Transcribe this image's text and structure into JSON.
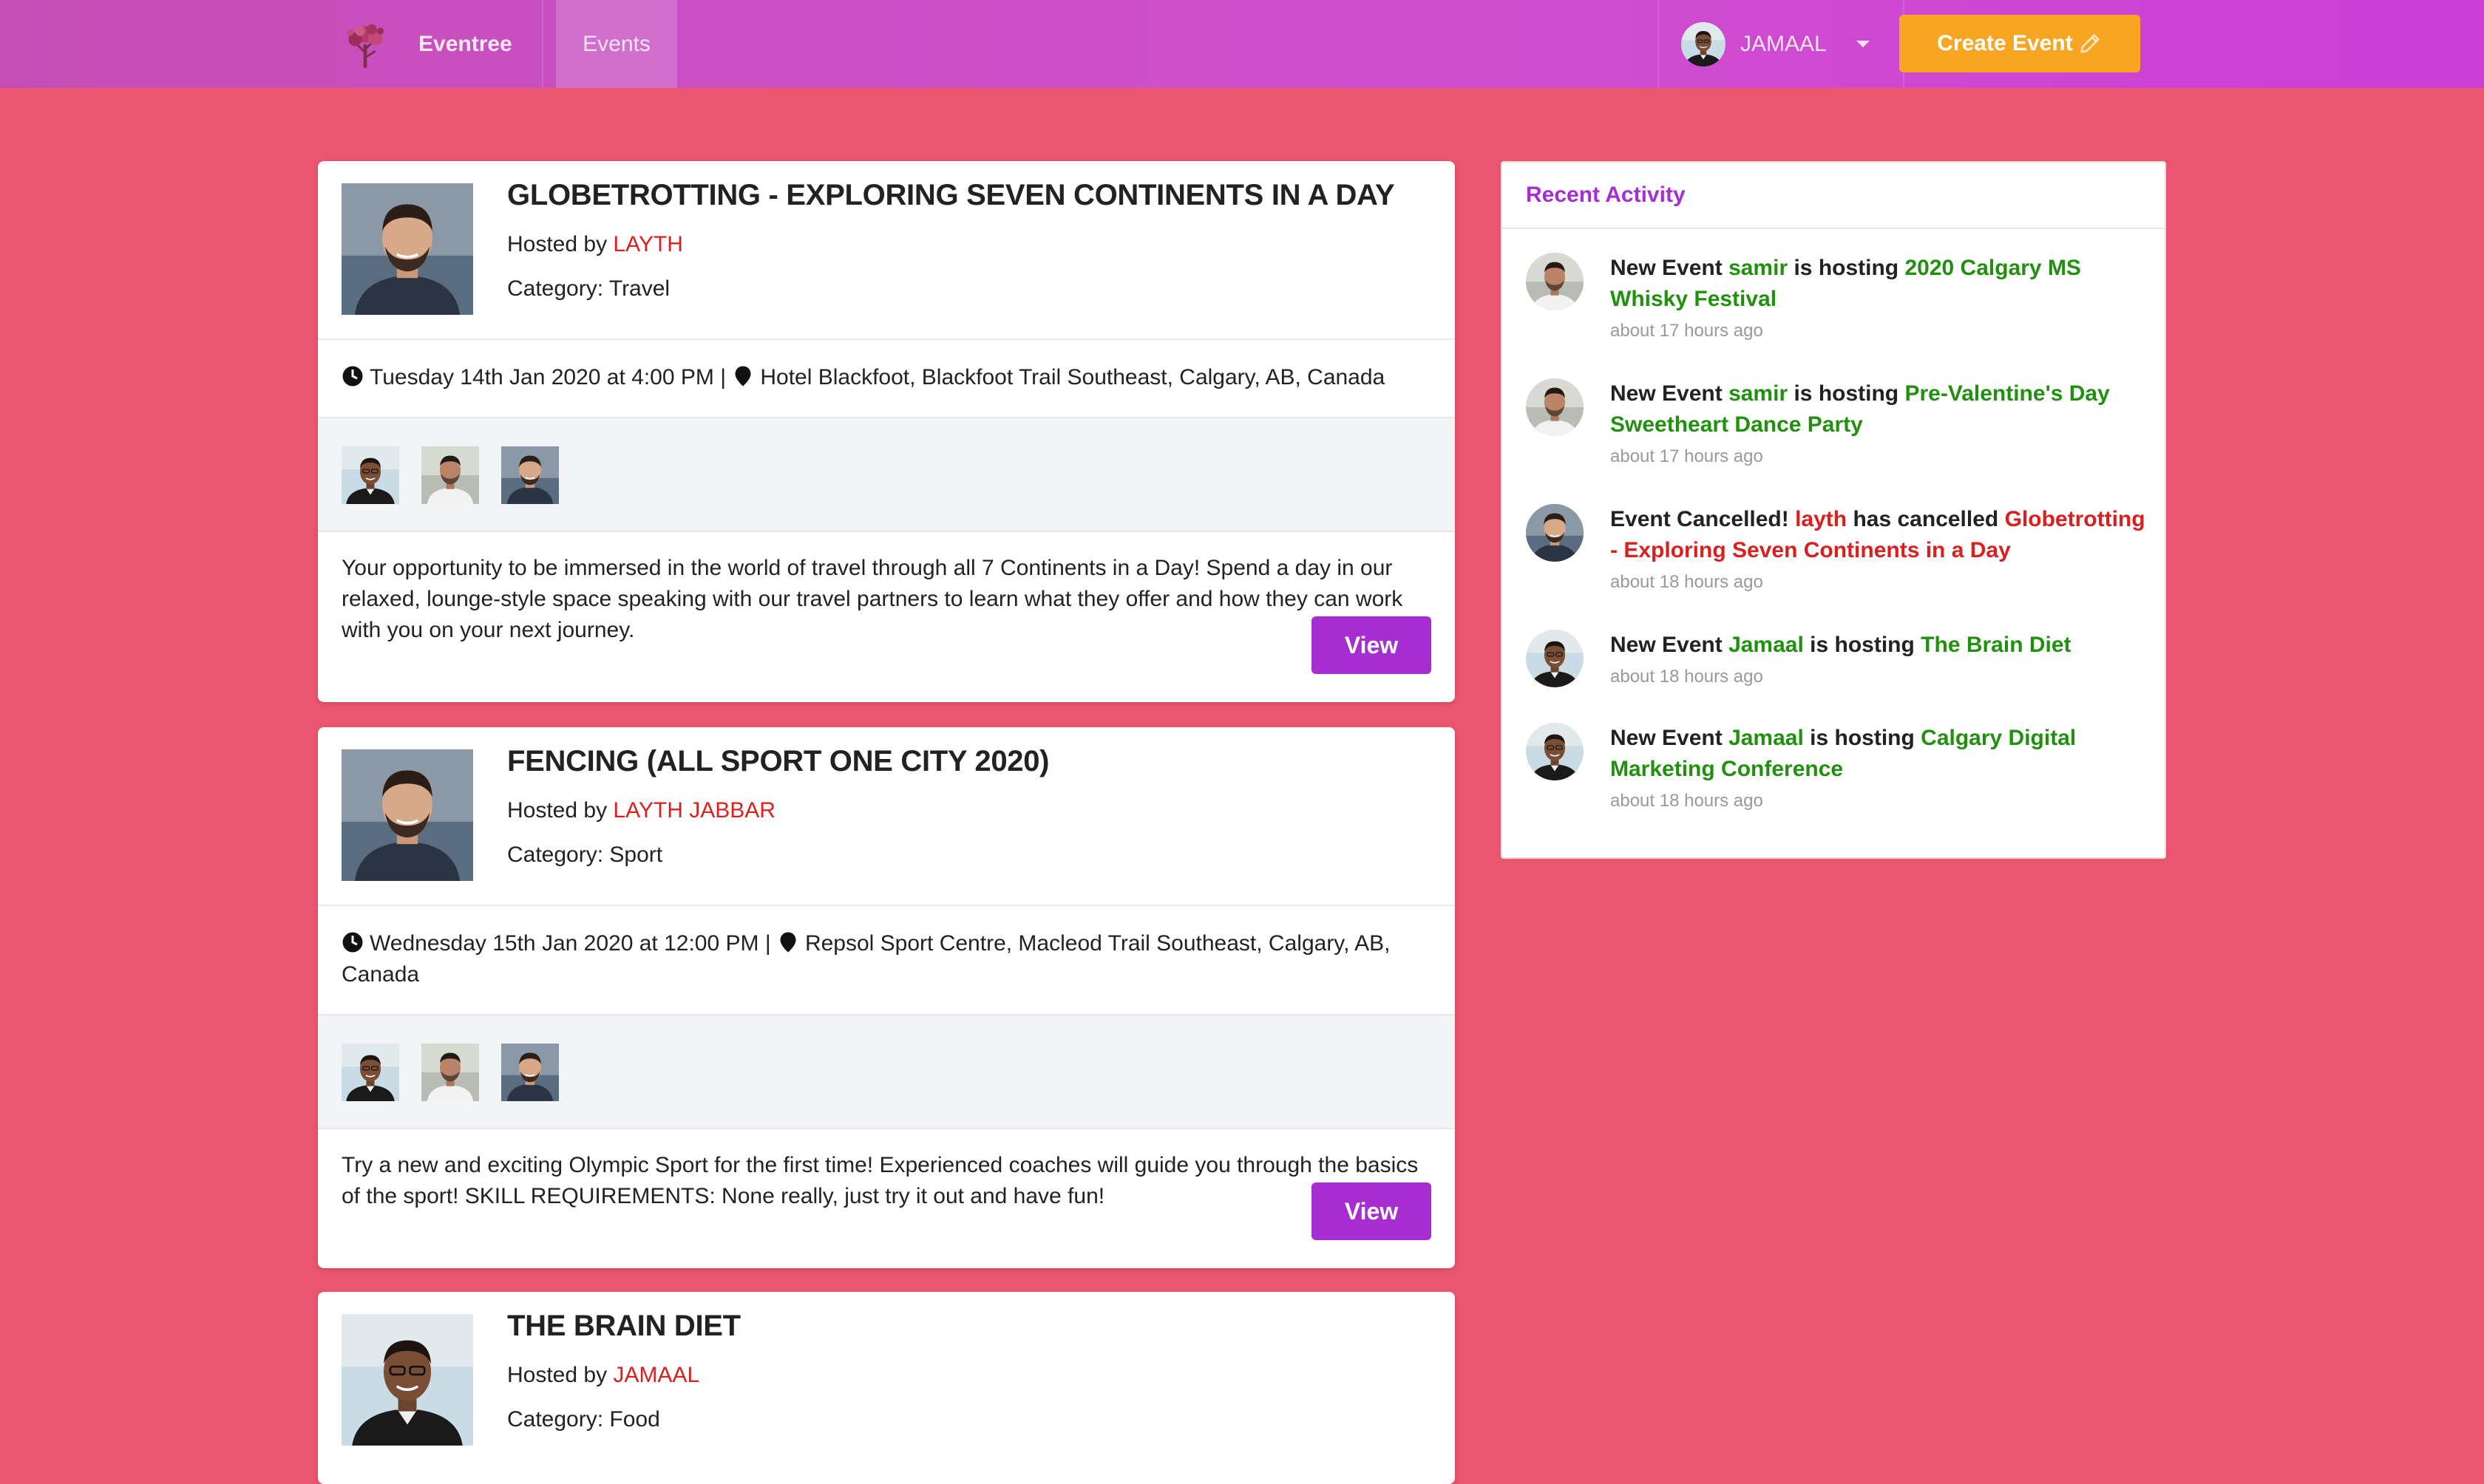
{
  "nav": {
    "brand": "Eventree",
    "events": "Events",
    "user": "JAMAAL",
    "create": "Create Event"
  },
  "events": [
    {
      "title": "GLOBETROTTING - EXPLORING SEVEN CONTINENTS IN A DAY",
      "hosted_prefix": "Hosted by",
      "host": "LAYTH",
      "category": "Category: Travel",
      "datetime": "Tuesday 14th Jan 2020 at 4:00 PM |",
      "venue": "Hotel Blackfoot, Blackfoot Trail Southeast, Calgary, AB, Canada",
      "description": "Your opportunity to be immersed in the world of travel through all 7 Continents in a Day! Spend a day in our relaxed, lounge-style space speaking with our travel partners to learn what they offer and how they can work with you on your next journey.",
      "view": "View"
    },
    {
      "title": "FENCING (ALL SPORT ONE CITY 2020)",
      "hosted_prefix": "Hosted by",
      "host": "LAYTH JABBAR",
      "category": "Category: Sport",
      "datetime": "Wednesday 15th Jan 2020 at 12:00 PM |",
      "venue": "Repsol Sport Centre, Macleod Trail Southeast, Calgary, AB, Canada",
      "description": "Try a new and exciting Olympic Sport for the first time! Experienced coaches will guide you through the basics of the sport! SKILL REQUIREMENTS: None really, just try it out and have fun!",
      "view": "View"
    },
    {
      "title": "THE BRAIN DIET",
      "hosted_prefix": "Hosted by",
      "host": "JAMAAL",
      "category": "Category: Food"
    }
  ],
  "activity": {
    "title": "Recent Activity",
    "items": [
      {
        "label": "New Event",
        "user": "samir",
        "verb": "is hosting",
        "event": "2020 Calgary MS Whisky Festival",
        "time": "about 17 hours ago"
      },
      {
        "label": "New Event",
        "user": "samir",
        "verb": "is hosting",
        "event": "Pre-Valentine's Day Sweetheart Dance Party",
        "time": "about 17 hours ago"
      },
      {
        "label": "Event Cancelled!",
        "user": "layth",
        "verb": "has cancelled",
        "event": "Globetrotting - Exploring Seven Continents in a Day",
        "time": "about 18 hours ago"
      },
      {
        "label": "New Event",
        "user": "Jamaal",
        "verb": "is hosting",
        "event": "The Brain Diet",
        "time": "about 18 hours ago"
      },
      {
        "label": "New Event",
        "user": "Jamaal",
        "verb": "is hosting",
        "event": "Calgary Digital Marketing Conference",
        "time": "about 18 hours ago"
      }
    ]
  },
  "colors": {
    "background": "#ea5570",
    "navbar": "#cf4fcf",
    "create_button": "#f6a623",
    "view_button": "#a62ed0",
    "host_link": "#db1f1f",
    "activity_link": "#22900f"
  }
}
